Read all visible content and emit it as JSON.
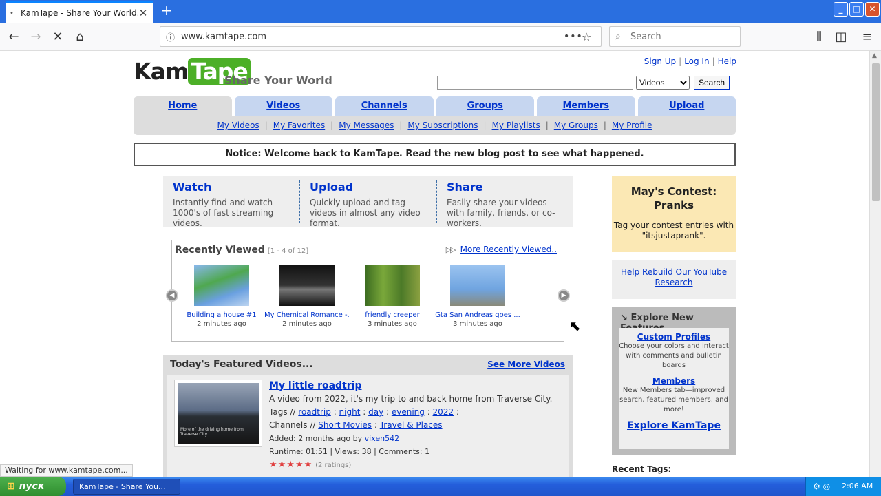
{
  "browser": {
    "tab_title": "KamTape - Share Your World.",
    "url": "www.kamtape.com",
    "search_placeholder": "Search",
    "status": "Waiting for www.kamtape.com..."
  },
  "site": {
    "logo_kam": "Kam",
    "logo_tape": "Tape",
    "tagline": "Share Your World",
    "top_links": [
      "Sign Up",
      "Log In",
      "Help"
    ],
    "search_select": "Videos",
    "search_button": "Search",
    "nav_tabs": [
      "Home",
      "Videos",
      "Channels",
      "Groups",
      "Members",
      "Upload"
    ],
    "sub_nav": [
      "My Videos",
      "My Favorites",
      "My Messages",
      "My Subscriptions",
      "My Playlists",
      "My Groups",
      "My Profile"
    ],
    "notice": "Notice: Welcome back to KamTape. Read the new blog post to see what happened."
  },
  "wus": [
    {
      "title": "Watch",
      "text": "Instantly find and watch 1000's of fast streaming videos."
    },
    {
      "title": "Upload",
      "text": "Quickly upload and tag videos in almost any video format."
    },
    {
      "title": "Share",
      "text": "Easily share your videos with family, friends, or co-workers."
    }
  ],
  "recent": {
    "header": "Recently Viewed",
    "count": "[1 - 4 of 12]",
    "more": "More Recently Viewed..",
    "items": [
      {
        "title": "Building a house #1",
        "ago": "2 minutes ago",
        "color": "#6fa0e0"
      },
      {
        "title": "My Chemical Romance -...",
        "ago": "2 minutes ago",
        "color": "#1a1a1a"
      },
      {
        "title": "friendly creeper",
        "ago": "3 minutes ago",
        "color": "#5a8a30"
      },
      {
        "title": "Gta San Andreas goes ...",
        "ago": "3 minutes ago",
        "color": "#7fb0e8"
      }
    ]
  },
  "featured": {
    "header": "Today's Featured Videos...",
    "more": "See More Videos",
    "video": {
      "title": "My little roadtrip",
      "desc": "A video from 2022, it's my trip to and back home from Traverse City.",
      "thumb_caption": "More of the driving home from Traverse City",
      "tags_label": "Tags //",
      "tags": [
        "roadtrip",
        "night",
        "day",
        "evening",
        "2022"
      ],
      "channels_label": "Channels //",
      "channels": [
        "Short Movies",
        "Travel & Places"
      ],
      "added": "Added: 2 months ago by",
      "author": "vixen542",
      "stats": "Runtime: 01:51 | Views: 38 | Comments: 1",
      "stars": "★★★★★",
      "ratings": "(2 ratings)"
    }
  },
  "sidebar": {
    "contest_title": "May's Contest: Pranks",
    "contest_text": "Tag your contest entries with \"itsjustaprank\".",
    "rebuild": "Help Rebuild Our YouTube Research",
    "explore_header": "Explore New Features",
    "features": [
      {
        "title": "Custom Profiles",
        "text": "Choose your colors and interact with comments and bulletin boards"
      },
      {
        "title": "Members",
        "text": "New Members tab—improved search, featured members, and more!"
      }
    ],
    "explore_link": "Explore KamTape",
    "recent_tags": "Recent Tags:"
  },
  "taskbar": {
    "start": "пуск",
    "item": "KamTape - Share You...",
    "clock": "2:06 AM"
  }
}
